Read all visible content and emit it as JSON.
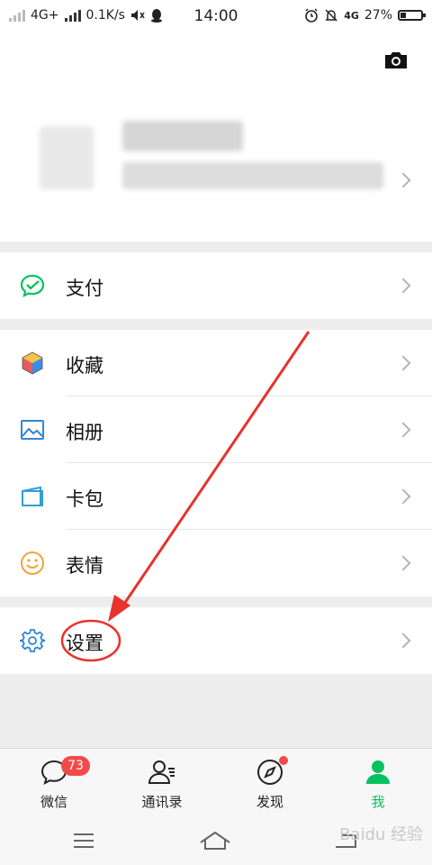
{
  "status_bar": {
    "network": "4G+",
    "speed": "0.1K/s",
    "time": "14:00",
    "network2": "4G",
    "battery": "27%",
    "battery_level": 0.27
  },
  "menu": {
    "payment": "支付",
    "favorites": "收藏",
    "album": "相册",
    "cards": "卡包",
    "stickers": "表情",
    "settings": "设置"
  },
  "tabs": [
    {
      "label": "微信",
      "badge": "73"
    },
    {
      "label": "通讯录"
    },
    {
      "label": "发现"
    },
    {
      "label": "我"
    }
  ],
  "colors": {
    "accent": "#07c160",
    "badge": "#f24a4a",
    "annotation": "#e8322e"
  },
  "watermark": "Baidu 经验"
}
